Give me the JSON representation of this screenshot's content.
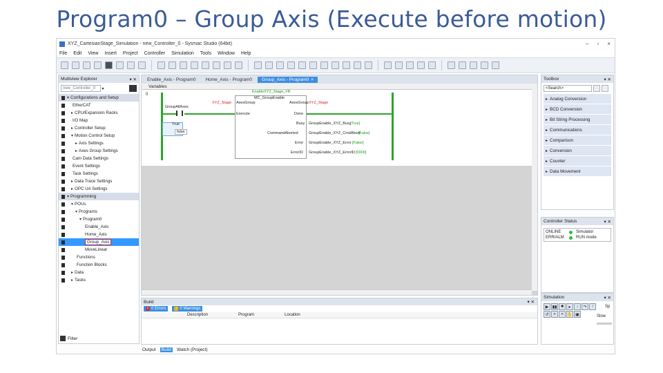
{
  "slide": {
    "title": "Program0 – Group Axis (Execute before motion)"
  },
  "window": {
    "title": "XYZ_CartesianStage_Simulation - new_Controller_0 - Sysmac Studio (64bit)"
  },
  "menu": [
    "File",
    "Edit",
    "View",
    "Insert",
    "Project",
    "Controller",
    "Simulation",
    "Tools",
    "Window",
    "Help"
  ],
  "multiview": {
    "header": "Multiview Explorer",
    "controller": "new_Controller_0",
    "tree": [
      {
        "label": "Configurations and Setup",
        "indent": 0,
        "arrow": "▾",
        "section": true
      },
      {
        "label": "EtherCAT",
        "indent": 1,
        "icon": "▸"
      },
      {
        "label": "CPU/Expansion Racks",
        "indent": 1,
        "arrow": "▸"
      },
      {
        "label": "I/O Map",
        "indent": 1
      },
      {
        "label": "Controller Setup",
        "indent": 1,
        "arrow": "▸"
      },
      {
        "label": "Motion Control Setup",
        "indent": 1,
        "arrow": "▾"
      },
      {
        "label": "Axis Settings",
        "indent": 2,
        "arrow": "▸"
      },
      {
        "label": "Axes Group Settings",
        "indent": 2,
        "arrow": "▸"
      },
      {
        "label": "Cam Data Settings",
        "indent": 1
      },
      {
        "label": "Event Settings",
        "indent": 1
      },
      {
        "label": "Task Settings",
        "indent": 1
      },
      {
        "label": "Data Trace Settings",
        "indent": 1,
        "arrow": "▸"
      },
      {
        "label": "OPC UA Settings",
        "indent": 1,
        "arrow": "▸"
      },
      {
        "label": "Programming",
        "indent": 0,
        "arrow": "▾",
        "section": true
      },
      {
        "label": "POUs",
        "indent": 1,
        "arrow": "▾"
      },
      {
        "label": "Programs",
        "indent": 2,
        "arrow": "▾"
      },
      {
        "label": "Program0",
        "indent": 3,
        "arrow": "▾"
      },
      {
        "label": "Enable_Axis",
        "indent": 4
      },
      {
        "label": "Home_Axis",
        "indent": 4
      },
      {
        "label": "Group_Axis",
        "indent": 4,
        "selected": true
      },
      {
        "label": "MoveLinear",
        "indent": 4
      },
      {
        "label": "Functions",
        "indent": 2
      },
      {
        "label": "Function Blocks",
        "indent": 2
      },
      {
        "label": "Data",
        "indent": 1,
        "arrow": "▸"
      },
      {
        "label": "Tasks",
        "indent": 1,
        "arrow": "▸"
      }
    ],
    "filter": "Filter"
  },
  "tabs": [
    {
      "label": "Enable_Axis - Program0",
      "active": false
    },
    {
      "label": "Home_Axis - Program0",
      "active": false
    },
    {
      "label": "Group_Axis - Program0",
      "active": true
    }
  ],
  "editor": {
    "variables": "Variables",
    "rung": "0",
    "fb_instance": "EnableXYZ_Stage_FB",
    "fb_type": "MC_GroupEnable",
    "in_axesgroup_var": "XYZ_Stage",
    "in_axesgroup": "AxesGroup",
    "out_axesgroup": "AxesGroup",
    "out_axesgroup_var": "XYZ_Stage",
    "execute": "Execute",
    "done": "Done",
    "busy": "Busy",
    "busy_var": "GroupEnable_XYZ_Busy",
    "busy_val": "[True]",
    "cmdaborted": "CommandAborted",
    "cmdaborted_var": "GroupEnable_XYZ_CmdAbort",
    "cmdaborted_val": "[False]",
    "error": "Error",
    "error_var": "GroupEnable_XYZ_Error",
    "error_val": "[False]",
    "errorid": "ErrorID",
    "errorid_var": "GroupEnable_XYZ_ErrorID",
    "errorid_val": "[0000]",
    "contact_var": "GroupAllAxes",
    "true_label": "True",
    "true_text": "false"
  },
  "build": {
    "header": "Build",
    "errors": "0 Errors",
    "warnings": "0 Warnings",
    "col_description": "Description",
    "col_program": "Program",
    "col_location": "Location"
  },
  "bottom_tabs": [
    {
      "label": "Output",
      "active": false
    },
    {
      "label": "Build",
      "active": true
    },
    {
      "label": "Watch (Project)",
      "active": false
    }
  ],
  "toolbox": {
    "header": "Toolbox",
    "search": "<Search>",
    "items": [
      "Analog Conversion",
      "BCD Conversion",
      "Bit String Processing",
      "Communications",
      "Comparison",
      "Conversion",
      "Counter",
      "Data Movement"
    ]
  },
  "controller_status": {
    "header": "Controller Status",
    "rows": [
      {
        "k": "ONLINE",
        "v": "Simulator"
      },
      {
        "k": "ERR/ALM",
        "v": "RUN mode"
      }
    ]
  },
  "simulation": {
    "header": "Simulation",
    "speed": "Sp",
    "slow": "Slow"
  }
}
